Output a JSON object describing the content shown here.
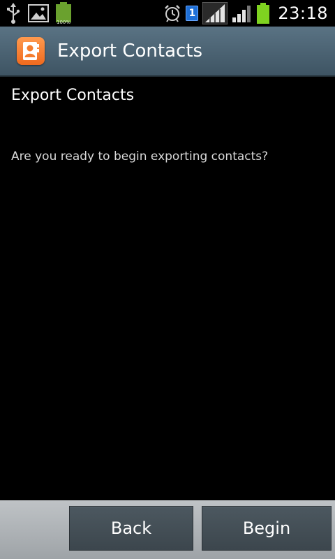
{
  "status_bar": {
    "time": "23:18",
    "battery_small_label": "100%",
    "sim_badge": "1",
    "icons": {
      "usb": "usb-icon",
      "gallery": "image-icon",
      "battery_notification": "battery-full-icon",
      "alarm": "alarm-clock-icon",
      "sim": "sim-1-icon",
      "signal_1": "signal-bars-icon",
      "signal_2": "signal-bars-icon",
      "battery": "battery-icon"
    }
  },
  "title_bar": {
    "title": "Export Contacts",
    "icon": "contacts-app-icon"
  },
  "content": {
    "heading": "Export Contacts",
    "message": "Are you ready to begin exporting contacts?"
  },
  "actions": {
    "back_label": "Back",
    "begin_label": "Begin"
  },
  "colors": {
    "title_bar": "#4d6473",
    "app_icon": "#f47d2f",
    "battery_green": "#7fd320",
    "sim_blue": "#1e6fd6",
    "button_bg": "#444e55",
    "action_bar_bg": "#aeb2b5"
  }
}
